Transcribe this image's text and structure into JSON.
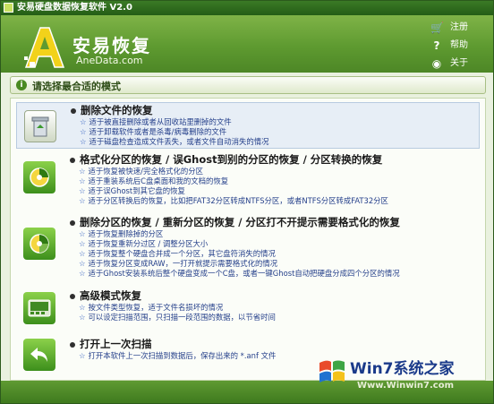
{
  "window": {
    "title": "安易硬盘数据恢复软件 V2.0"
  },
  "brand": {
    "name": "安易恢复",
    "site": "AneData.com"
  },
  "header_links": [
    {
      "label": "注册",
      "icon": "cart-icon"
    },
    {
      "label": "帮助",
      "icon": "help-icon"
    },
    {
      "label": "关于",
      "icon": "about-icon"
    }
  ],
  "mode_bar": {
    "label": "请选择最合适的模式"
  },
  "options": [
    {
      "title": "删除文件的恢复",
      "icon": "recycle-bin-icon",
      "lines": [
        "适于被直接删除或者从回收站里删掉的文件",
        "适于卸载软件或者是杀毒/病毒删除的文件",
        "适于磁盘检查造成文件丢失，或者文件自动消失的情况"
      ]
    },
    {
      "title": "格式化分区的恢复 / 误Ghost到别的分区的恢复 / 分区转换的恢复",
      "icon": "disk-format-icon",
      "lines": [
        "适于恢复被快速/完全格式化的分区",
        "适于重装系统后C盘桌面和我的文档的恢复",
        "适于误Ghost到其它盘的恢复",
        "适于分区转换后的恢复，比如把FAT32分区转成NTFS分区，或者NTFS分区转成FAT32分区"
      ]
    },
    {
      "title": "删除分区的恢复 / 重新分区的恢复 / 分区打不开提示需要格式化的恢复",
      "icon": "partition-icon",
      "lines": [
        "适于恢复删除掉的分区",
        "适于恢复重新分过区 / 调整分区大小",
        "适于恢复整个硬盘合并成一个分区，其它盘符消失的情况",
        "适于恢复分区变成RAW，一打开就提示需要格式化的情况",
        "适于Ghost安装系统后整个硬盘变成一个C盘，或者一键Ghost自动把硬盘分成四个分区的情况"
      ]
    },
    {
      "title": "高级模式恢复",
      "icon": "advanced-mode-icon",
      "lines": [
        "按文件类型恢复，适于文件名损坏的情况",
        "可以设定扫描范围，只扫描一段范围的数据，以节省时间"
      ]
    },
    {
      "title": "打开上一次扫描",
      "icon": "back-arrow-icon",
      "lines": [
        "打开本软件上一次扫描到数据后，保存出来的 *.anf 文件"
      ]
    }
  ],
  "watermark": {
    "text": "Win7系统之家",
    "url": "Www.Winwin7.com"
  },
  "colors": {
    "header_green": "#5e9a30",
    "link_blue": "#243f8a",
    "selected_bg": "#e7eef6"
  }
}
